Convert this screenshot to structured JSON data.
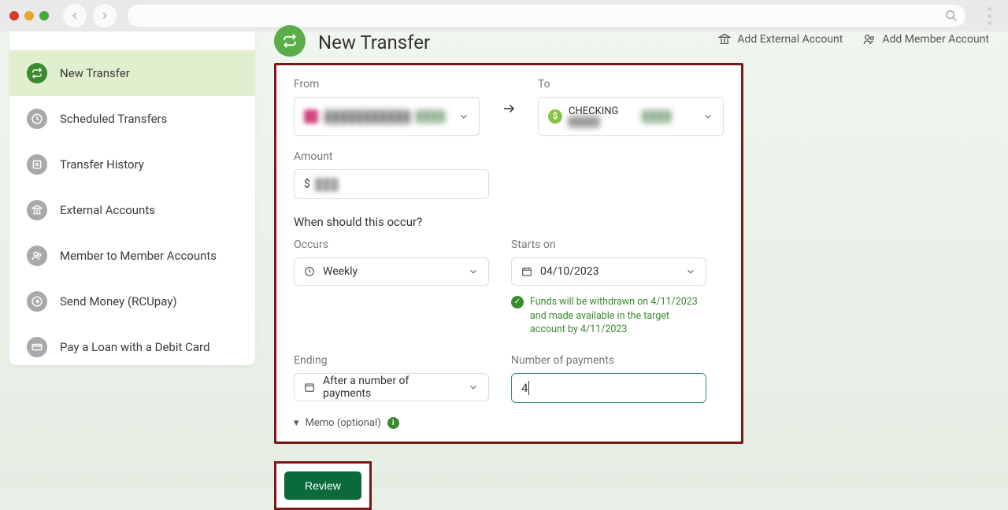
{
  "sidebar": {
    "items": [
      {
        "label": "New Transfer",
        "icon": "swap"
      },
      {
        "label": "Scheduled Transfers",
        "icon": "clock"
      },
      {
        "label": "Transfer History",
        "icon": "history"
      },
      {
        "label": "External Accounts",
        "icon": "bank"
      },
      {
        "label": "Member to Member Accounts",
        "icon": "people"
      },
      {
        "label": "Send Money (RCUpay)",
        "icon": "send"
      },
      {
        "label": "Pay a Loan with a Debit Card",
        "icon": "card"
      }
    ]
  },
  "header": {
    "title": "New Transfer",
    "actions": {
      "add_external": "Add External Account",
      "add_member": "Add Member Account"
    }
  },
  "form": {
    "from_label": "From",
    "to_label": "To",
    "from_account": {
      "name_masked": "blurtext",
      "balance_masked": "blur"
    },
    "to_account": {
      "name": "CHECKING",
      "sub_masked": "",
      "balance_masked": "blur"
    },
    "amount_label": "Amount",
    "amount_prefix": "$",
    "amount_masked": "blur",
    "schedule_q": "When should this occur?",
    "occurs_label": "Occurs",
    "occurs_value": "Weekly",
    "starts_label": "Starts on",
    "starts_value": "04/10/2023",
    "funds_note": "Funds will be withdrawn on 4/11/2023 and made available in the target account by 4/11/2023",
    "ending_label": "Ending",
    "ending_value": "After a number of payments",
    "num_payments_label": "Number of payments",
    "num_payments_value": "4",
    "memo_label": "Memo (optional)"
  },
  "buttons": {
    "review": "Review"
  }
}
